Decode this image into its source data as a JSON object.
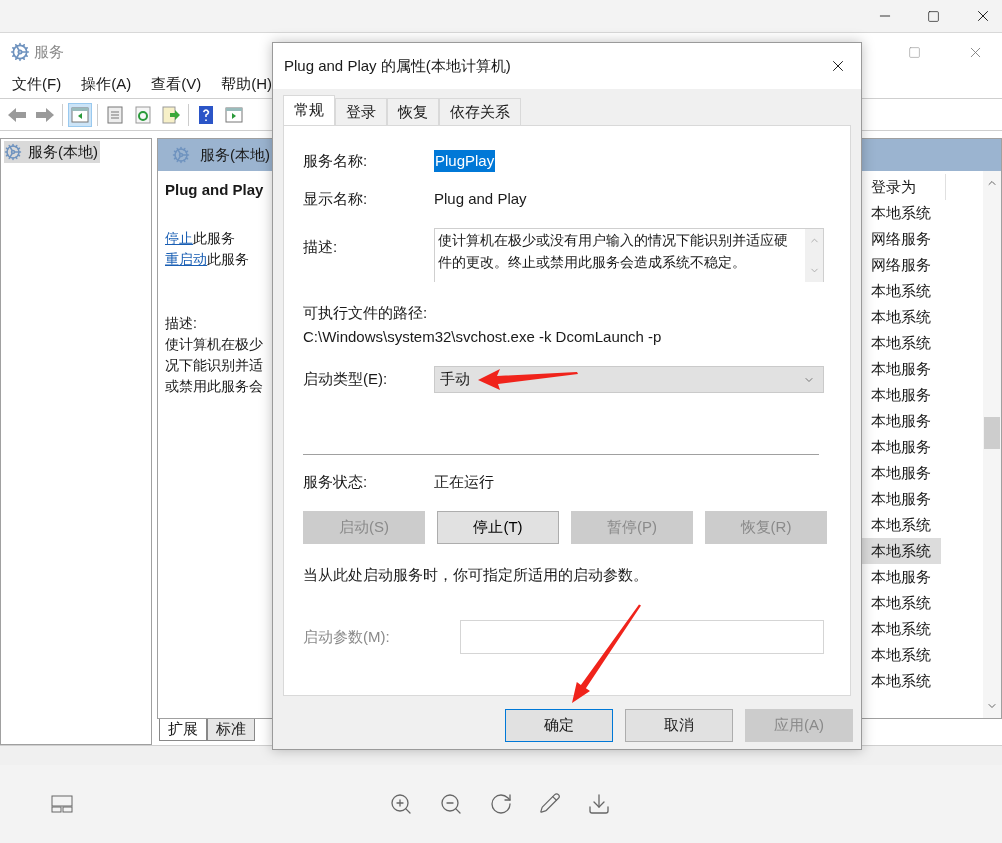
{
  "services_window": {
    "title": "服务",
    "menu": [
      "文件(F)",
      "操作(A)",
      "查看(V)",
      "帮助(H)"
    ],
    "tree": [
      {
        "label": "服务(本地)",
        "selected": true
      }
    ],
    "pane_header": "服务(本地)",
    "service_name": "Plug and Play",
    "actions": [
      {
        "link": "停止",
        "text": "此服务"
      },
      {
        "link": "重启动",
        "text": "此服务"
      }
    ],
    "description_label": "描述:",
    "description_lines": [
      "使计算机在极少",
      "况下能识别并适",
      "或禁用此服务会"
    ],
    "logon_column": {
      "header": "登录为",
      "rows": [
        {
          "text": "本地系统",
          "selected": false
        },
        {
          "text": "网络服务",
          "selected": false
        },
        {
          "text": "网络服务",
          "selected": false
        },
        {
          "text": "本地系统",
          "selected": false
        },
        {
          "text": "本地系统",
          "selected": false
        },
        {
          "text": "本地系统",
          "selected": false
        },
        {
          "text": "本地服务",
          "selected": false
        },
        {
          "text": "本地服务",
          "selected": false
        },
        {
          "text": "本地服务",
          "selected": false
        },
        {
          "text": "本地服务",
          "selected": false
        },
        {
          "text": "本地服务",
          "selected": false
        },
        {
          "text": "本地服务",
          "selected": false
        },
        {
          "text": "本地系统",
          "selected": false
        },
        {
          "text": "本地系统",
          "selected": true
        },
        {
          "text": "本地服务",
          "selected": false
        },
        {
          "text": "本地系统",
          "selected": false
        },
        {
          "text": "本地系统",
          "selected": false
        },
        {
          "text": "本地系统",
          "selected": false
        },
        {
          "text": "本地系统",
          "selected": false
        }
      ]
    },
    "bottom_tabs": [
      {
        "label": "扩展",
        "selected": true
      },
      {
        "label": "标准",
        "selected": false
      }
    ]
  },
  "dialog": {
    "title": "Plug and Play 的属性(本地计算机)",
    "tabs": [
      {
        "label": "常规",
        "selected": true
      },
      {
        "label": "登录",
        "selected": false
      },
      {
        "label": "恢复",
        "selected": false
      },
      {
        "label": "依存关系",
        "selected": false
      }
    ],
    "service_name": {
      "label": "服务名称:",
      "value": "PlugPlay"
    },
    "display_name": {
      "label": "显示名称:",
      "value": "Plug and Play"
    },
    "description": {
      "label": "描述:",
      "value": "使计算机在极少或没有用户输入的情况下能识别并适应硬件的更改。终止或禁用此服务会造成系统不稳定。"
    },
    "path": {
      "label": "可执行文件的路径:",
      "value": "C:\\Windows\\system32\\svchost.exe -k DcomLaunch -p"
    },
    "startup_type": {
      "label": "启动类型(E):",
      "value": "手动"
    },
    "status": {
      "label": "服务状态:",
      "value": "正在运行"
    },
    "control_buttons": [
      {
        "label": "启动(S)",
        "disabled": true
      },
      {
        "label": "停止(T)",
        "disabled": false
      },
      {
        "label": "暂停(P)",
        "disabled": true
      },
      {
        "label": "恢复(R)",
        "disabled": true
      }
    ],
    "hint": "当从此处启动服务时，你可指定所适用的启动参数。",
    "start_params": {
      "label": "启动参数(M):",
      "disabled": true
    },
    "buttons": [
      {
        "label": "确定",
        "disabled": false,
        "default": true
      },
      {
        "label": "取消",
        "disabled": false,
        "default": false
      },
      {
        "label": "应用(A)",
        "disabled": true,
        "default": false
      }
    ]
  }
}
